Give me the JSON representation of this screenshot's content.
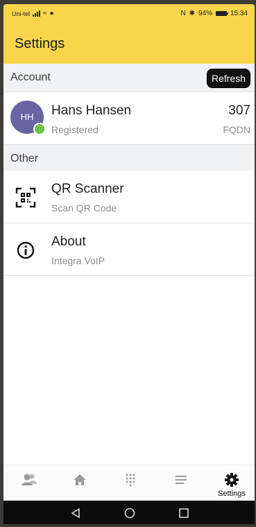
{
  "status": {
    "carrier": "Uni-tel",
    "battery": "94%",
    "time": "15:34"
  },
  "header": {
    "title": "Settings"
  },
  "account": {
    "section_label": "Account",
    "refresh_label": "Refresh",
    "initials": "HH",
    "name": "Hans Hansen",
    "status": "Registered",
    "extension": "307",
    "domain_label": "FQDN"
  },
  "other": {
    "section_label": "Other",
    "items": [
      {
        "title": "QR Scanner",
        "subtitle": "Scan QR Code",
        "icon": "qr-code-icon"
      },
      {
        "title": "About",
        "subtitle": "Integra VoIP",
        "icon": "info-icon"
      }
    ]
  },
  "bottom_nav": {
    "items": [
      {
        "icon": "contacts-icon",
        "label": ""
      },
      {
        "icon": "home-icon",
        "label": ""
      },
      {
        "icon": "dialpad-icon",
        "label": ""
      },
      {
        "icon": "list-icon",
        "label": ""
      },
      {
        "icon": "gear-icon",
        "label": "Settings",
        "active": true
      }
    ]
  },
  "colors": {
    "app_bar": "#f8d54a",
    "avatar": "#6a64a3",
    "presence": "#6cc24a"
  }
}
